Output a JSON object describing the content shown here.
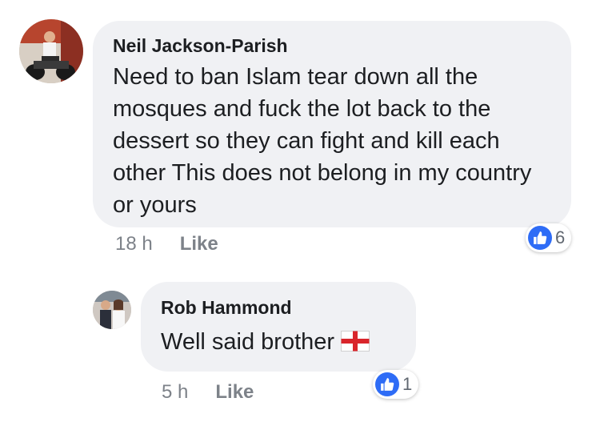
{
  "comments": [
    {
      "author": "Neil Jackson-Parish",
      "text": "Need to ban Islam tear down all the mosques and fuck the lot back to the dessert so they can fight and kill each other This does not belong in my country or yours",
      "time": "18 h",
      "like_label": "Like",
      "reaction_count": "6",
      "avatar_icon": "person-on-motorbike-photo"
    },
    {
      "author": "Rob Hammond",
      "text": "Well said brother",
      "emoji": "england-flag-icon",
      "time": "5 h",
      "like_label": "Like",
      "reaction_count": "1",
      "avatar_icon": "couple-photo"
    }
  ],
  "colors": {
    "bubble": "#f0f1f4",
    "like_blue": "#2e6cf6",
    "meta_text": "#7d8289",
    "flag_red": "#d9252b"
  }
}
